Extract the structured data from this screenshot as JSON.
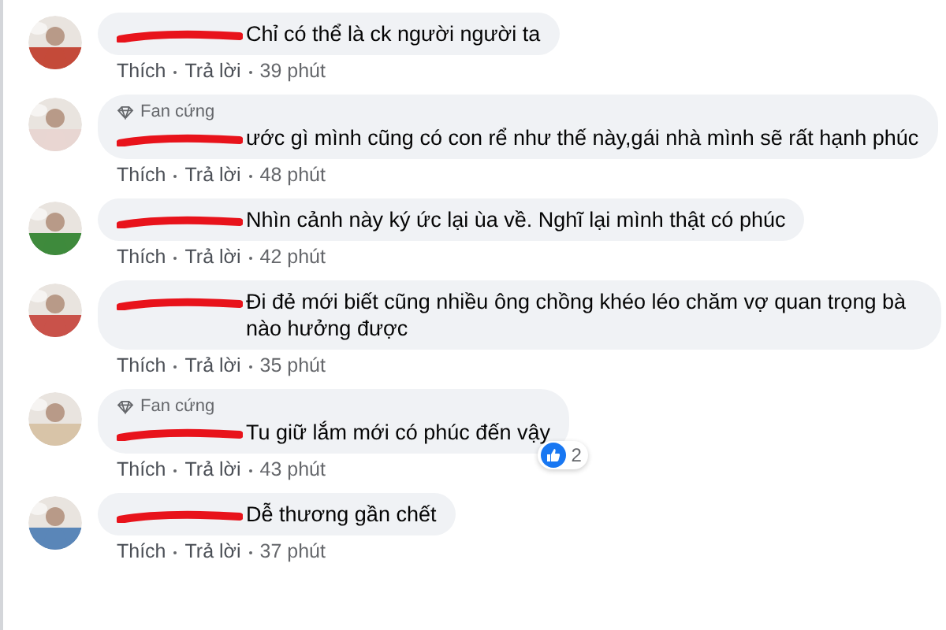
{
  "comments": [
    {
      "name_redacted": true,
      "text": "Chỉ có thể là ck người người ta",
      "like_label": "Thích",
      "reply_label": "Trả lời",
      "time": "39 phút"
    },
    {
      "badge": "Fan cứng",
      "name_redacted": true,
      "text": "ước gì mình cũng có con rể như thế này,gái nhà mình sẽ rất hạnh phúc",
      "like_label": "Thích",
      "reply_label": "Trả lời",
      "time": "48 phút"
    },
    {
      "name_redacted": true,
      "text": "Nhìn cảnh này ký ức lại ùa về. Nghĩ lại mình thật có phúc",
      "like_label": "Thích",
      "reply_label": "Trả lời",
      "time": "42 phút"
    },
    {
      "name_redacted": true,
      "text": "Đi đẻ mới biết cũng nhiều ông chồng khéo léo chăm vợ quan trọng bà nào hưởng được",
      "like_label": "Thích",
      "reply_label": "Trả lời",
      "time": "35 phút"
    },
    {
      "badge": "Fan cứng",
      "name_redacted": true,
      "text": "Tu giữ lắm mới có phúc đến vậy",
      "like_label": "Thích",
      "reply_label": "Trả lời",
      "time": "43 phút",
      "reactions": "2"
    },
    {
      "name_redacted": true,
      "text": "Dễ thương gần chết",
      "like_label": "Thích",
      "reply_label": "Trả lời",
      "time": "37 phút"
    }
  ]
}
